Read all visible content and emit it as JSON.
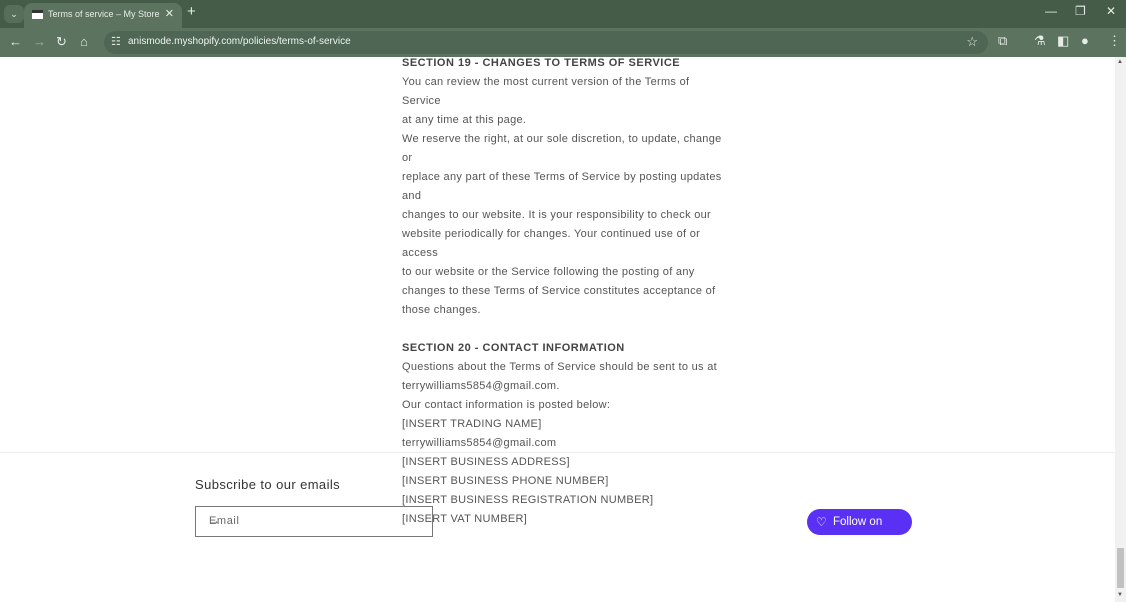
{
  "browser": {
    "tab_title": "Terms of service – My Store",
    "url": "anismode.myshopify.com/policies/terms-of-service"
  },
  "content": {
    "section19_title": "SECTION 19 - CHANGES TO TERMS OF SERVICE",
    "section19_lines": [
      "You can review the most current version of the Terms of Service",
      "at any time at this page.",
      "We reserve the right, at our sole discretion, to update, change or",
      "replace any part of these Terms of Service by posting updates and",
      "changes to our website. It is your responsibility to check our",
      "website periodically for changes. Your continued use of or access",
      "to our website or the Service following the posting of any",
      "changes to these Terms of Service constitutes acceptance of",
      "those changes."
    ],
    "section20_title": "SECTION 20 - CONTACT INFORMATION",
    "section20_lines": [
      "Questions about the Terms of Service should be sent to us at",
      "terrywilliams5854@gmail.com.",
      "Our contact information is posted below:",
      "[INSERT TRADING NAME]",
      "terrywilliams5854@gmail.com",
      "[INSERT BUSINESS ADDRESS]",
      "[INSERT BUSINESS PHONE NUMBER]",
      "[INSERT BUSINESS REGISTRATION NUMBER]",
      "[INSERT VAT NUMBER]"
    ]
  },
  "footer": {
    "subscribe_title": "Subscribe to our emails",
    "email_placeholder": "Email",
    "follow_label": "Follow on",
    "follow_brand": "shop",
    "follow_color": "#5a31f4"
  }
}
